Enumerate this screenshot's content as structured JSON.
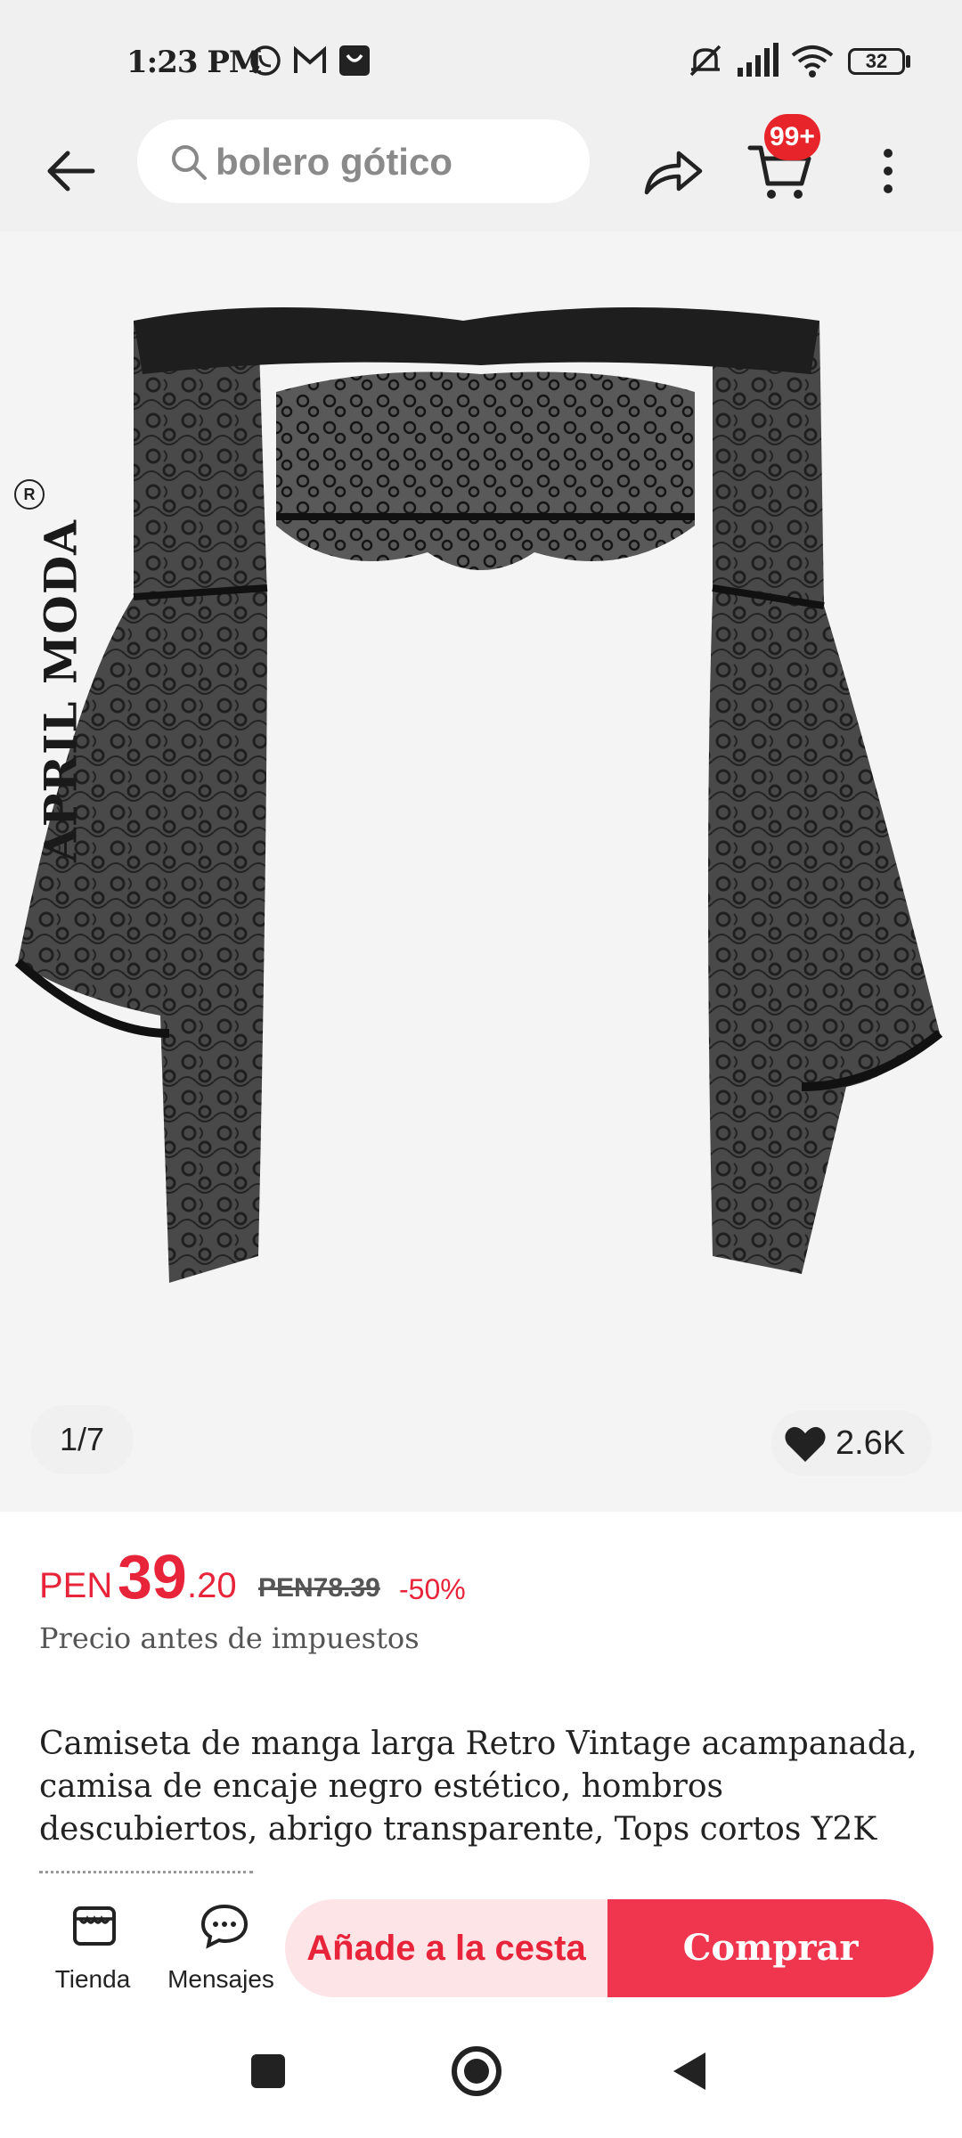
{
  "status_bar": {
    "time": "1:23 PM",
    "battery": "32",
    "icons": [
      "whatsapp-icon",
      "gmail-icon",
      "shopping-bag-icon",
      "mute-icon",
      "signal-icon",
      "wifi-icon",
      "battery-icon"
    ]
  },
  "header": {
    "search_text": "bolero gótico",
    "cart_badge": "99+",
    "icons": [
      "back-arrow-icon",
      "search-icon",
      "share-icon",
      "cart-icon",
      "more-vert-icon"
    ]
  },
  "gallery": {
    "brand": "APRIL MODA",
    "registered_mark": "R",
    "pager": "1/7",
    "likes": "2.6K"
  },
  "product": {
    "currency": "PEN",
    "price_integer": "39",
    "price_decimal": ".20",
    "old_price": "PEN78.39",
    "discount": "-50%",
    "tax_note": "Precio antes de impuestos",
    "title": "Camiseta de manga larga Retro Vintage acampanada, camisa de encaje negro estético, hombros descubiertos, abrigo transparente, Tops cortos Y2K"
  },
  "action_bar": {
    "store_label": "Tienda",
    "messages_label": "Mensajes",
    "add_to_cart": "Añade a la cesta",
    "buy": "Comprar"
  },
  "colors": {
    "accent": "#e8243b",
    "buy_button": "#f0354f",
    "cart_button_bg": "#fde4e6",
    "header_bg": "#f0f0f0"
  }
}
